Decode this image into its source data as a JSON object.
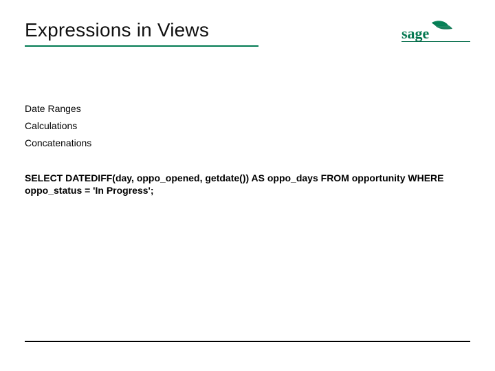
{
  "colors": {
    "accent": "#007a52"
  },
  "logo": {
    "name": "sage-logo",
    "text": "sage"
  },
  "title": "Expressions in Views",
  "bullets": [
    "Date Ranges",
    "Calculations",
    "Concatenations"
  ],
  "code": "SELECT DATEDIFF(day, oppo_opened, getdate()) AS oppo_days FROM opportunity WHERE oppo_status = 'In Progress';"
}
